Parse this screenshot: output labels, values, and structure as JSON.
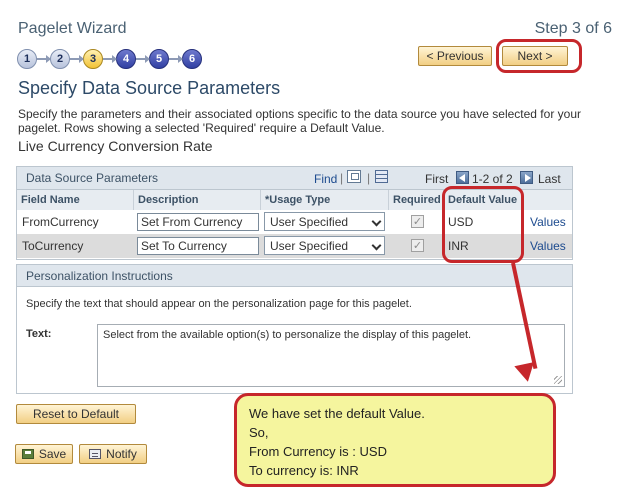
{
  "wizard": {
    "title": "Pagelet Wizard",
    "step_label": "Step 3 of 6",
    "steps": [
      "1",
      "2",
      "3",
      "4",
      "5",
      "6"
    ],
    "current_step": 3,
    "prev_label": "< Previous",
    "next_label": "Next >"
  },
  "page": {
    "heading": "Specify Data Source Parameters",
    "description": "Specify the parameters and their associated options specific to the data source you have selected for your pagelet.  Rows showing a selected 'Required' require a Default Value.",
    "subheading": "Live Currency Conversion Rate"
  },
  "grid": {
    "title": "Data Source Parameters",
    "find_label": "Find",
    "separator": "|",
    "pager_first": "First",
    "pager_count": "1-2 of 2",
    "pager_last": "Last",
    "columns": [
      "Field Name",
      "Description",
      "*Usage Type",
      "Required",
      "Default Value"
    ],
    "rows": [
      {
        "field": "FromCurrency",
        "description": "Set From Currency",
        "usage": "User Specified",
        "required": true,
        "default_value": "USD",
        "link": "Values"
      },
      {
        "field": "ToCurrency",
        "description": "Set To Currency",
        "usage": "User Specified",
        "required": true,
        "default_value": "INR",
        "link": "Values"
      }
    ]
  },
  "personalization": {
    "title": "Personalization Instructions",
    "description": "Specify the text that should appear on the personalization page for this pagelet.",
    "text_label": "Text:",
    "text_value": "Select from the available option(s) to personalize the display of this pagelet."
  },
  "buttons": {
    "reset": "Reset to Default",
    "save": "Save",
    "notify": "Notify"
  },
  "callout": {
    "line1": "We have set the default Value.",
    "line2": "So,",
    "line3": "From Currency is : USD",
    "line4": "To currency is: INR"
  },
  "icons": [
    "zoom-icon",
    "grid-download-icon",
    "first-page-arrow-icon",
    "next-page-arrow-icon",
    "save-icon",
    "notify-icon",
    "dropdown-arrow-icon",
    "resize-grip-icon"
  ],
  "colors": {
    "highlight": "#c6272b",
    "callout_bg": "#f5f59e",
    "button_gradient_top": "#fff4d6",
    "button_gradient_bottom": "#f2cf84",
    "link": "#1d4b8f"
  }
}
